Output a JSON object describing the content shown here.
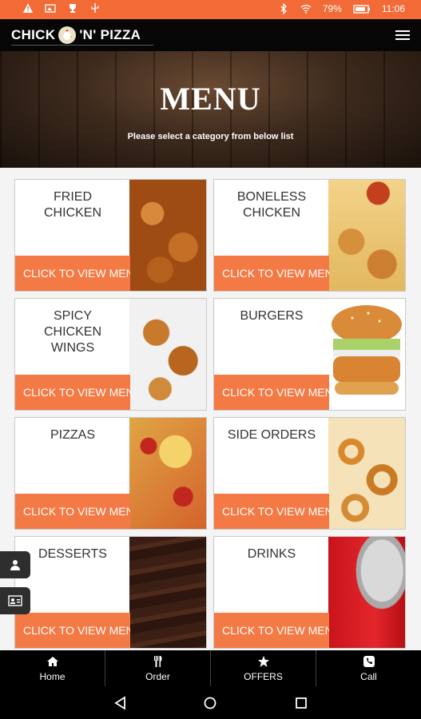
{
  "status_bar": {
    "battery_percent": "79%",
    "time": "11:06",
    "icons": [
      "warning-icon",
      "image-icon",
      "trophy-icon",
      "usb-icon",
      "bluetooth-icon",
      "wifi-icon",
      "battery-icon"
    ]
  },
  "app": {
    "logo_left": "CHICK",
    "logo_right": "'N' PIZZA",
    "menu_icon": "hamburger-icon"
  },
  "hero": {
    "title": "MENU",
    "subtitle": "Please select a category from below list"
  },
  "categories": [
    {
      "label": "FRIED CHICKEN",
      "cta": "CLICK TO VIEW MENU"
    },
    {
      "label": "BONELESS CHICKEN",
      "cta": "CLICK TO VIEW MENU"
    },
    {
      "label": "SPICY CHICKEN WINGS",
      "cta": "CLICK TO VIEW MENU"
    },
    {
      "label": "BURGERS",
      "cta": "CLICK TO VIEW MENU"
    },
    {
      "label": "PIZZAS",
      "cta": "CLICK TO VIEW MENU"
    },
    {
      "label": "SIDE ORDERS",
      "cta": "CLICK TO VIEW MENU"
    },
    {
      "label": "DESSERTS",
      "cta": "CLICK TO VIEW MENU"
    },
    {
      "label": "DRINKS",
      "cta": "CLICK TO VIEW MENU"
    }
  ],
  "bottom_nav": [
    {
      "label": "Home",
      "icon": "home-icon"
    },
    {
      "label": "Order",
      "icon": "cutlery-icon"
    },
    {
      "label": "OFFERS",
      "icon": "star-icon"
    },
    {
      "label": "Call",
      "icon": "phone-icon"
    }
  ],
  "colors": {
    "accent": "#f26a36",
    "cta": "#f47a45",
    "header": "#060606"
  }
}
